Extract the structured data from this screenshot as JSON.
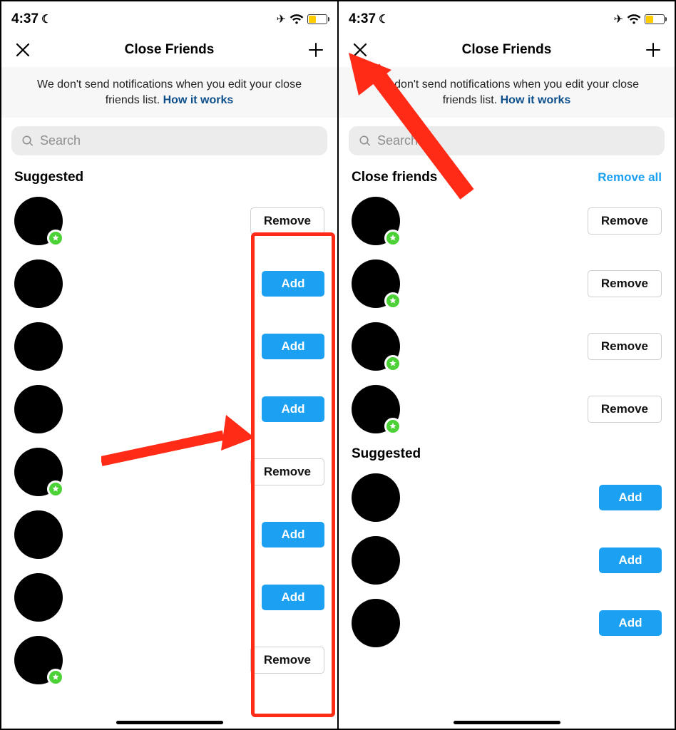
{
  "status": {
    "time": "4:37",
    "airplane": true,
    "wifi": true
  },
  "nav": {
    "title": "Close Friends"
  },
  "banner": {
    "text": "We don't send notifications when you edit your close friends list.",
    "link": "How it works"
  },
  "search": {
    "placeholder": "Search"
  },
  "left": {
    "section1": {
      "title": "Suggested"
    },
    "rows": [
      {
        "star": true,
        "action": "remove"
      },
      {
        "star": false,
        "action": "add"
      },
      {
        "star": false,
        "action": "add"
      },
      {
        "star": false,
        "action": "add"
      },
      {
        "star": true,
        "action": "remove"
      },
      {
        "star": false,
        "action": "add"
      },
      {
        "star": false,
        "action": "add"
      },
      {
        "star": true,
        "action": "remove"
      }
    ]
  },
  "right": {
    "section1": {
      "title": "Close friends",
      "remove_all": "Remove all"
    },
    "close_rows": [
      {
        "star": true,
        "action": "remove"
      },
      {
        "star": true,
        "action": "remove"
      },
      {
        "star": true,
        "action": "remove"
      },
      {
        "star": true,
        "action": "remove"
      }
    ],
    "section2": {
      "title": "Suggested"
    },
    "sugg_rows": [
      {
        "star": false,
        "action": "add"
      },
      {
        "star": false,
        "action": "add"
      },
      {
        "star": false,
        "action": "add"
      }
    ]
  },
  "labels": {
    "add": "Add",
    "remove": "Remove"
  }
}
